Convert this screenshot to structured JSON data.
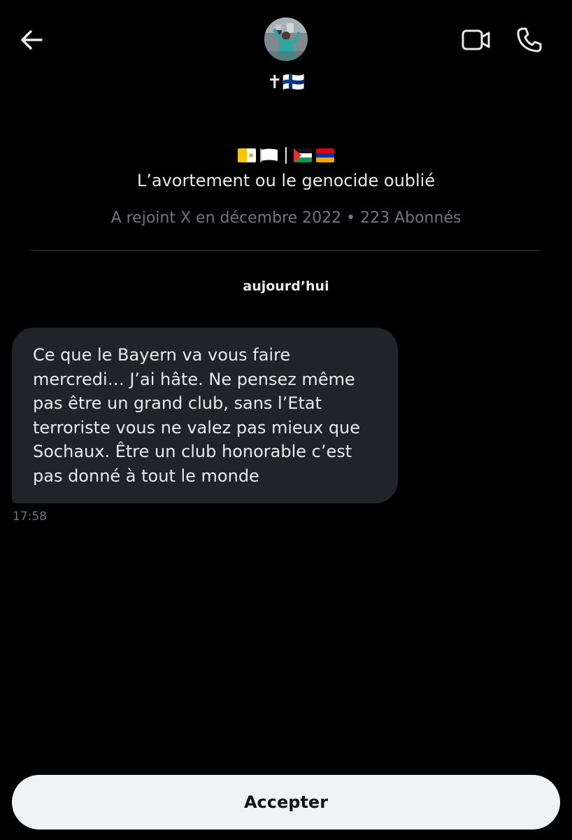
{
  "header": {
    "back_icon": "arrow-left-icon",
    "display_name": "✝🇫🇮",
    "video_icon": "video-camera-icon",
    "call_icon": "phone-icon"
  },
  "profile": {
    "bio_flags": [
      "vatican-flag",
      "white-flag",
      "palestine-flag",
      "armenia-flag"
    ],
    "bio": "L’avortement ou le genocide oublié",
    "joined": "A rejoint X en décembre 2022 • 223 Abonnés"
  },
  "conversation": {
    "date_separator": "aujourd’hui",
    "messages": [
      {
        "text": "Ce que le Bayern va vous faire mercredi… J’ai hâte. Ne pensez même pas être un grand club, sans l’Etat terroriste vous ne valez pas mieux que Sochaux. Être un club honorable c’est pas donné à tout le monde",
        "time": "17:58"
      }
    ]
  },
  "actions": {
    "accept_label": "Accepter"
  },
  "colors": {
    "background": "#000000",
    "bubble": "#202327",
    "text": "#e7e9ea",
    "secondary_text": "#71767b",
    "button_bg": "#eff3f4",
    "button_text": "#0f1419"
  }
}
